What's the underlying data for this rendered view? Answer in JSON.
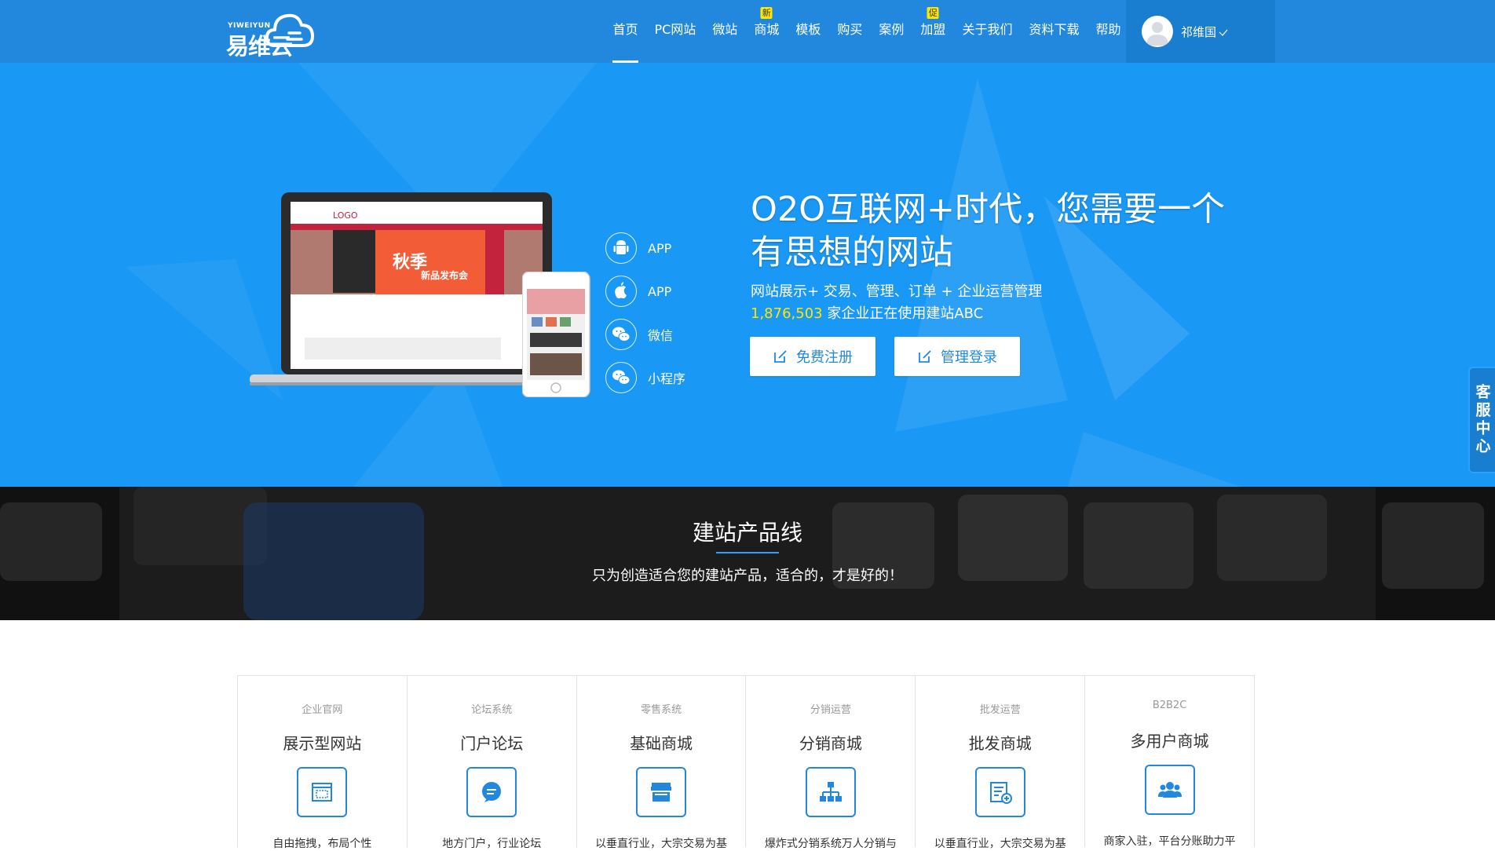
{
  "header": {
    "logo_en": "YIWEIYUN",
    "logo_cn": "易维云",
    "nav": [
      {
        "label": "首页",
        "badge": ""
      },
      {
        "label": "PC网站",
        "badge": ""
      },
      {
        "label": "微站",
        "badge": ""
      },
      {
        "label": "商城",
        "badge": "新"
      },
      {
        "label": "模板",
        "badge": ""
      },
      {
        "label": "购买",
        "badge": ""
      },
      {
        "label": "案例",
        "badge": ""
      },
      {
        "label": "加盟",
        "badge": "促"
      },
      {
        "label": "关于我们",
        "badge": ""
      },
      {
        "label": "资料下载",
        "badge": ""
      },
      {
        "label": "帮助",
        "badge": ""
      }
    ],
    "user_name": "祁维国"
  },
  "hero": {
    "laptop_logo": "LOGO",
    "banner_text1": "秋季",
    "banner_text2": "新品发布会",
    "platforms": [
      {
        "label": "APP",
        "icon": "android-icon"
      },
      {
        "label": "APP",
        "icon": "apple-icon"
      },
      {
        "label": "微信",
        "icon": "wechat-icon"
      },
      {
        "label": "小程序",
        "icon": "miniprogram-icon"
      }
    ],
    "title": "O2O互联网+时代，您需要一个有思想的网站",
    "subtitle": "网站展示+ 交易、管理、订单 + 企业运营管理",
    "stat_number": "1,876,503",
    "stat_text": " 家企业正在使用建站ABC",
    "btn_register": "免费注册",
    "btn_login": "管理登录"
  },
  "service": {
    "label": "客服中心"
  },
  "product_band": {
    "title": "建站产品线",
    "subtitle": "只为创造适合您的建站产品，适合的，才是好的！"
  },
  "products": [
    {
      "category": "企业官网",
      "name": "展示型网站",
      "desc": "自由拖拽，布局个性",
      "icon": "layout-icon"
    },
    {
      "category": "论坛系统",
      "name": "门户论坛",
      "desc": "地方门户，行业论坛",
      "icon": "chat-icon"
    },
    {
      "category": "零售系统",
      "name": "基础商城",
      "desc": "以垂直行业，大宗交易为基",
      "icon": "store-icon"
    },
    {
      "category": "分销运营",
      "name": "分销商城",
      "desc": "爆炸式分销系统万人分销与",
      "icon": "hierarchy-icon"
    },
    {
      "category": "批发运营",
      "name": "批发商城",
      "desc": "以垂直行业，大宗交易为基",
      "icon": "list-add-icon"
    },
    {
      "category": "B2B2C",
      "name": "多用户商城",
      "desc": "商家入驻，平台分账助力平",
      "icon": "users-icon"
    }
  ],
  "colors": {
    "brand_blue": "#2288dd",
    "hero_blue": "#1a98f5",
    "highlight_yellow": "#ffe600"
  }
}
